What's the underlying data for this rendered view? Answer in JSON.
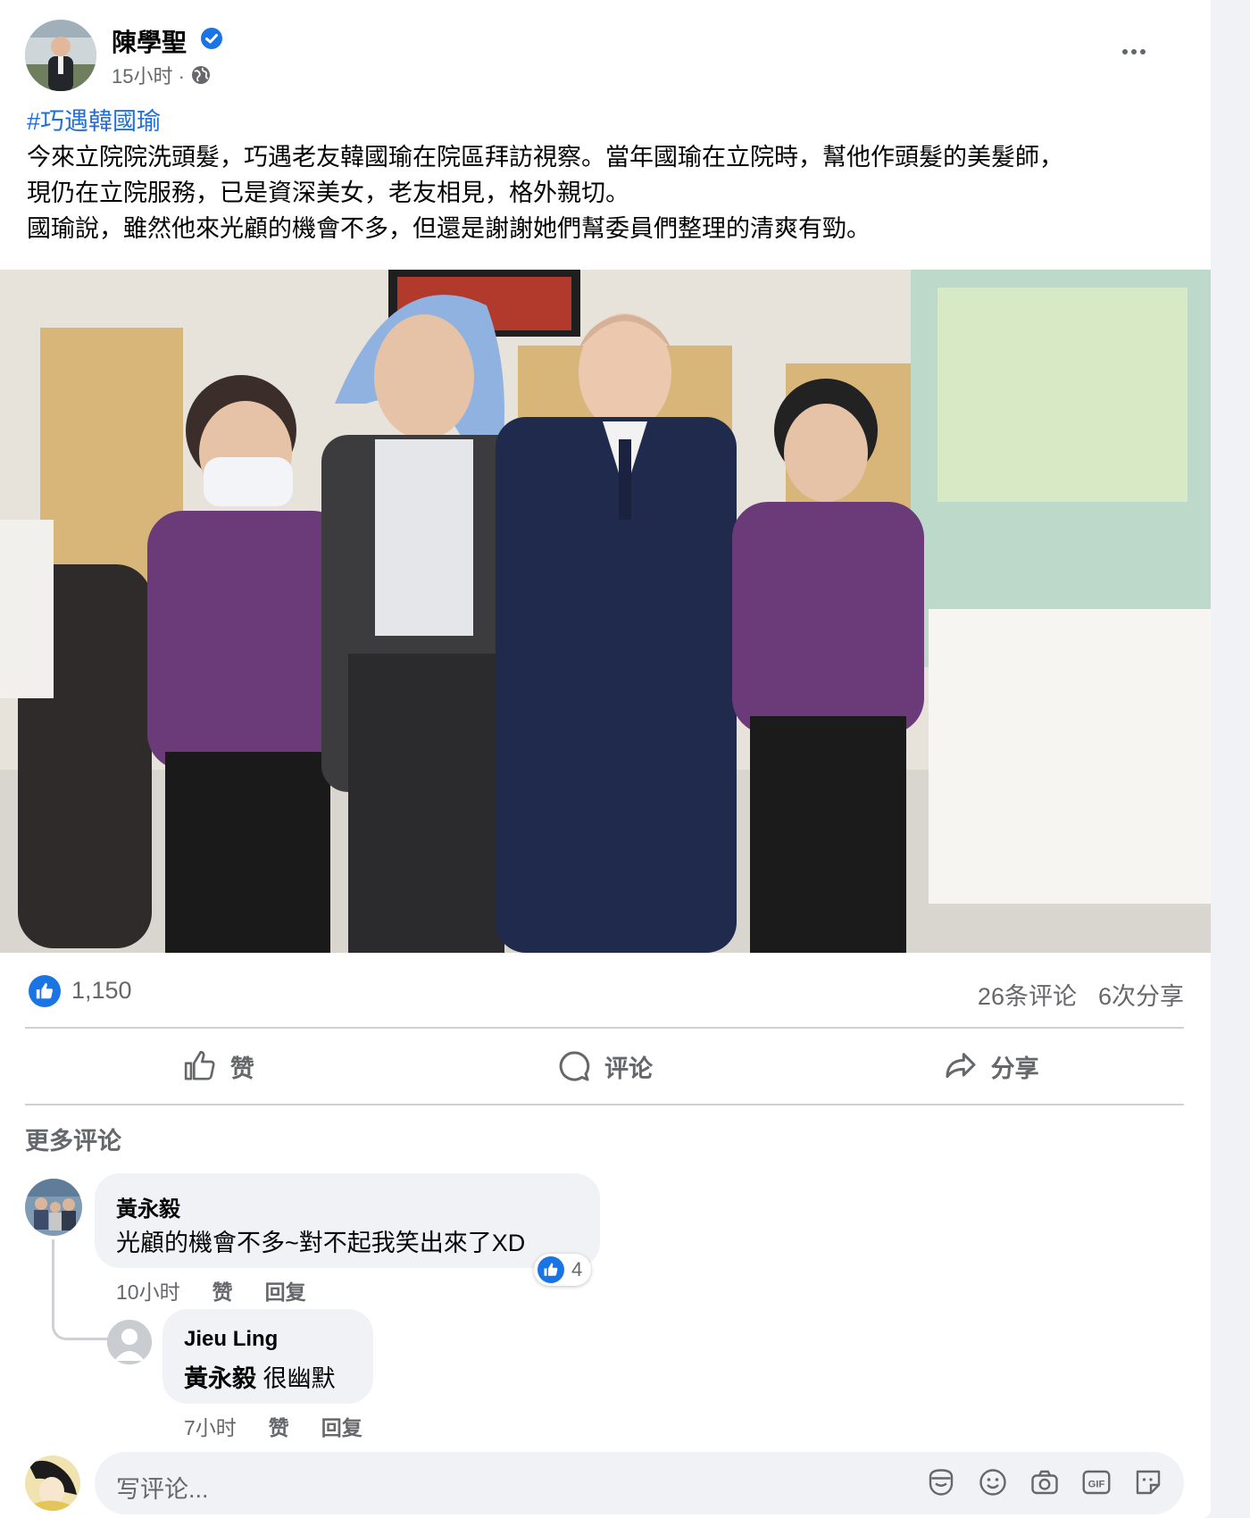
{
  "post": {
    "author": "陳學聖",
    "time": "15小时 ·",
    "hashtag": "#巧遇韓國瑜",
    "lines": [
      "今來立院院洗頭髮，巧遇老友韓國瑜在院區拜訪視察。當年國瑜在立院時，幫他作頭髮的美髮師，",
      "現仍在立院服務，已是資深美女，老友相見，格外親切。",
      "國瑜說，雖然他來光顧的機會不多，但還是謝謝她們幫委員們整理的清爽有勁。"
    ]
  },
  "stats": {
    "likes": "1,150",
    "comments": "26条评论",
    "shares": "6次分享"
  },
  "actions": {
    "like": "赞",
    "comment": "评论",
    "share": "分享"
  },
  "comments_section": {
    "more_label": "更多评论",
    "items": [
      {
        "name": "黃永毅",
        "text": "光顧的機會不多~對不起我笑出來了XD",
        "time": "10小时",
        "like": "赞",
        "reply": "回复",
        "reaction_count": "4"
      },
      {
        "name": "Jieu Ling",
        "mention": "黃永毅",
        "text": " 很幽默",
        "time": "7小时",
        "like": "赞",
        "reply": "回复"
      }
    ]
  },
  "composer": {
    "placeholder": "写评论..."
  },
  "colors": {
    "accent": "#1b74e4",
    "link": "#216fdb",
    "muted": "#65676b",
    "bubble": "#f0f2f5"
  }
}
